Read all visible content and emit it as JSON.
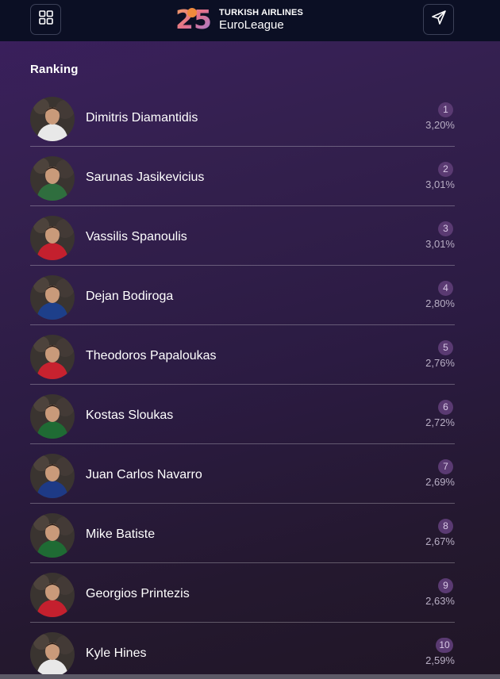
{
  "header": {
    "logo": {
      "number": "25",
      "line1": "TURKISH AIRLINES",
      "line2": "EuroLeague"
    },
    "left_button_icon": "grid-icon",
    "right_button_icon": "send-icon"
  },
  "section": {
    "title": "Ranking"
  },
  "ranking": [
    {
      "rank": "1",
      "name": "Dimitris Diamantidis",
      "percent": "3,20%",
      "jersey_color": "#e8e8e8"
    },
    {
      "rank": "2",
      "name": "Sarunas Jasikevicius",
      "percent": "3,01%",
      "jersey_color": "#2f6e3e"
    },
    {
      "rank": "3",
      "name": "Vassilis Spanoulis",
      "percent": "3,01%",
      "jersey_color": "#c4202e"
    },
    {
      "rank": "4",
      "name": "Dejan Bodiroga",
      "percent": "2,80%",
      "jersey_color": "#1d3f8a"
    },
    {
      "rank": "5",
      "name": "Theodoros Papaloukas",
      "percent": "2,76%",
      "jersey_color": "#c7222f"
    },
    {
      "rank": "6",
      "name": "Kostas Sloukas",
      "percent": "2,72%",
      "jersey_color": "#1f6b34"
    },
    {
      "rank": "7",
      "name": "Juan Carlos Navarro",
      "percent": "2,69%",
      "jersey_color": "#1e3a86"
    },
    {
      "rank": "8",
      "name": "Mike Batiste",
      "percent": "2,67%",
      "jersey_color": "#1f6b34"
    },
    {
      "rank": "9",
      "name": "Georgios Printezis",
      "percent": "2,63%",
      "jersey_color": "#c4202e"
    },
    {
      "rank": "10",
      "name": "Kyle Hines",
      "percent": "2,59%",
      "jersey_color": "#e8e8e8"
    }
  ]
}
